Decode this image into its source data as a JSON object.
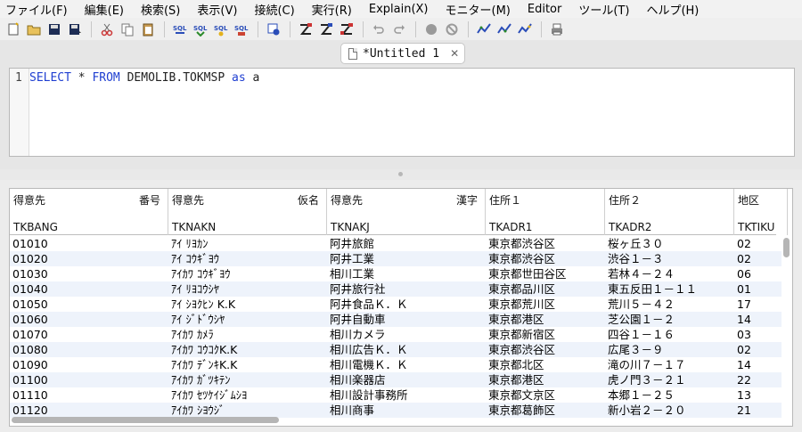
{
  "menu": [
    "ファイル(F)",
    "編集(E)",
    "検索(S)",
    "表示(V)",
    "接続(C)",
    "実行(R)",
    "Explain(X)",
    "モニター(M)",
    "Editor",
    "ツール(T)",
    "ヘルプ(H)"
  ],
  "toolbar_icons": [
    "new-file-icon",
    "open-folder-icon",
    "save-icon",
    "save-as-icon",
    "cut-icon",
    "copy-icon",
    "paste-icon",
    "sql-icon",
    "sql-icon",
    "sql-icon",
    "sql-icon",
    "explain-connect-icon",
    "run-icon",
    "run-step-icon",
    "run-all-icon",
    "undo-icon",
    "redo-icon",
    "stop-icon",
    "cancel-icon",
    "monitor-icon",
    "monitor-icon",
    "monitor-icon",
    "print-icon"
  ],
  "tab": {
    "title": "*Untitled 1",
    "close": "✕"
  },
  "editor": {
    "line_number": "1",
    "tokens": [
      {
        "t": "SELECT",
        "k": true
      },
      {
        "t": " * ",
        "k": false
      },
      {
        "t": "FROM",
        "k": true
      },
      {
        "t": " DEMOLIB.TOKMSP ",
        "k": false
      },
      {
        "t": "as",
        "k": true
      },
      {
        "t": " a",
        "k": false
      }
    ]
  },
  "grid": {
    "columns": [
      {
        "label_left": "得意先",
        "label_right": "番号",
        "name": "TKBANG"
      },
      {
        "label_left": "得意先",
        "label_right": "仮名",
        "name": "TKNAKN"
      },
      {
        "label_left": "得意先",
        "label_right": "漢字",
        "name": "TKNAKJ"
      },
      {
        "label_left": "住所１",
        "label_right": "",
        "name": "TKADR1"
      },
      {
        "label_left": "住所２",
        "label_right": "",
        "name": "TKADR2"
      },
      {
        "label_left": "地区",
        "label_right": "",
        "name": "TKTIKU"
      }
    ],
    "rows": [
      [
        "01010",
        "ｱｲ ﾘﾖｶﾝ",
        "阿井旅館",
        "東京都渋谷区",
        "桜ヶ丘３０",
        "02"
      ],
      [
        "01020",
        "ｱｲ ｺｳｷﾞﾖｳ",
        "阿井工業",
        "東京都渋谷区",
        "渋谷１－３",
        "02"
      ],
      [
        "01030",
        "ｱｲｶﾜ ｺｳｷﾞﾖｳ",
        "相川工業",
        "東京都世田谷区",
        "若林４－２４",
        "06"
      ],
      [
        "01040",
        "ｱｲ ﾘﾖｺｳｼﾔ",
        "阿井旅行社",
        "東京都品川区",
        "東五反田１－１１",
        "01"
      ],
      [
        "01050",
        "ｱｲ ｼﾖｸﾋﾝ K.K",
        "阿井食品Ｋ．Ｋ",
        "東京都荒川区",
        "荒川５－４２",
        "17"
      ],
      [
        "01060",
        "ｱｲ ｼﾞﾄﾞｳｼﾔ",
        "阿井自動車",
        "東京都港区",
        "芝公園１－２",
        "14"
      ],
      [
        "01070",
        "ｱｲｶﾜ ｶﾒﾗ",
        "相川カメラ",
        "東京都新宿区",
        "四谷１－１６",
        "03"
      ],
      [
        "01080",
        "ｱｲｶﾜ ｺｳｺｸK.K",
        "相川広告Ｋ．Ｋ",
        "東京都渋谷区",
        "広尾３－９",
        "02"
      ],
      [
        "01090",
        "ｱｲｶﾜ ﾃﾞﾝｷK.K",
        "相川電機Ｋ．Ｋ",
        "東京都北区",
        "滝の川７－１７",
        "14"
      ],
      [
        "01100",
        "ｱｲｶﾜ ｶﾞﾂｷﾃﾝ",
        "相川楽器店",
        "東京都港区",
        "虎ノ門３－２１",
        "22"
      ],
      [
        "01110",
        "ｱｲｶﾜ ｾﾂｹｲｼﾞﾑｼﾖ",
        "相川設計事務所",
        "東京都文京区",
        "本郷１－２５",
        "13"
      ],
      [
        "01120",
        "ｱｲｶﾜ ｼﾖｳｼﾞ",
        "相川商事",
        "東京都葛飾区",
        "新小岩２－２０",
        "21"
      ]
    ]
  },
  "colors": {
    "keyword": "#1f3fd1",
    "row_alt": "#eef3fb"
  }
}
